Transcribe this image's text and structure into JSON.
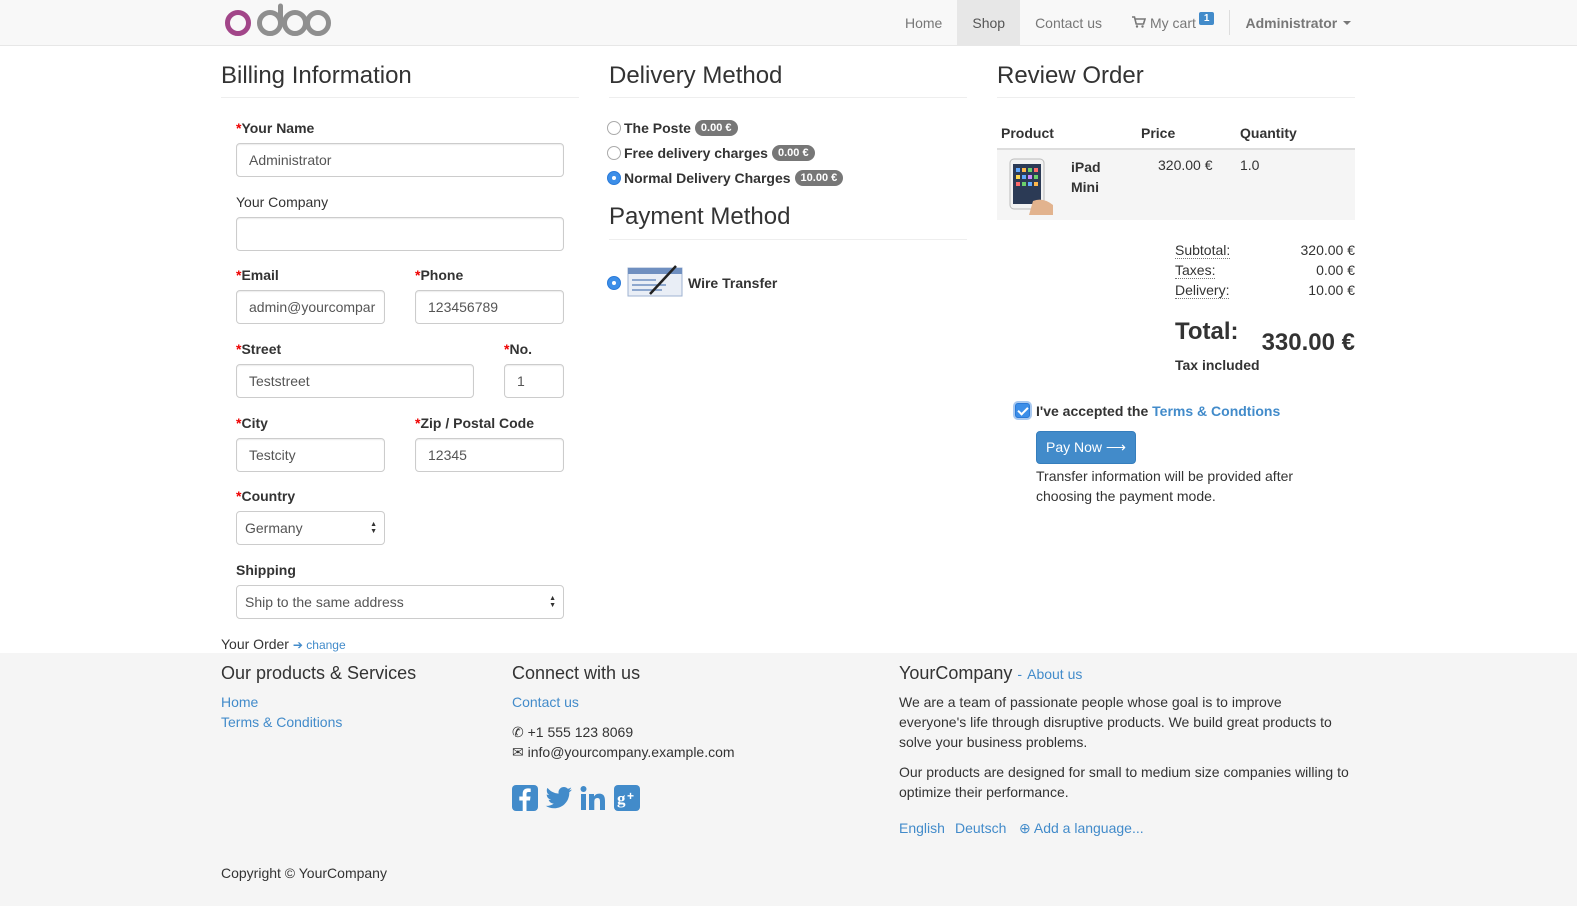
{
  "brand": {
    "logo_text": "odoo",
    "logo_color": "#a24689"
  },
  "nav": {
    "home": "Home",
    "shop": "Shop",
    "contact": "Contact us",
    "cart": "My cart",
    "cart_count": "1",
    "user": "Administrator"
  },
  "billing": {
    "title": "Billing Information",
    "required_mark": "*",
    "name_label": "Your Name",
    "name_value": "Administrator",
    "company_label": "Your Company",
    "company_value": "",
    "email_label": "Email",
    "email_value": "admin@yourcompar",
    "phone_label": "Phone",
    "phone_value": "123456789",
    "street_label": "Street",
    "street_value": "Teststreet",
    "no_label": "No.",
    "no_value": "1",
    "city_label": "City",
    "city_value": "Testcity",
    "zip_label": "Zip / Postal Code",
    "zip_value": "12345",
    "country_label": "Country",
    "country_value": "Germany",
    "shipping_label": "Shipping",
    "shipping_value": "Ship to the same address",
    "your_order_label": "Your Order",
    "change_link": "change"
  },
  "delivery": {
    "title": "Delivery Method",
    "options": [
      {
        "label": "The Poste",
        "price": "0.00 €",
        "selected": false
      },
      {
        "label": "Free delivery charges",
        "price": "0.00 €",
        "selected": false
      },
      {
        "label": "Normal Delivery Charges",
        "price": "10.00 €",
        "selected": true
      }
    ]
  },
  "payment": {
    "title": "Payment Method",
    "option_label": "Wire Transfer"
  },
  "review": {
    "title": "Review Order",
    "col_product": "Product",
    "col_price": "Price",
    "col_quantity": "Quantity",
    "item_name_1": "iPad",
    "item_name_2": "Mini",
    "item_price": "320.00 €",
    "item_qty": "1.0",
    "subtotal_label": "Subtotal:",
    "subtotal_value": "320.00 €",
    "taxes_label": "Taxes:",
    "taxes_value": "0.00 €",
    "delivery_label": "Delivery:",
    "delivery_value": "10.00 €",
    "total_label": "Total:",
    "total_value": "330.00 €",
    "tax_included": "Tax included",
    "accept_text": "I've accepted the",
    "terms_link": "Terms & Condtions",
    "pay_button": "Pay Now",
    "transfer_info_1": "Transfer information will be provided after",
    "transfer_info_2": "choosing the payment mode."
  },
  "footer": {
    "products_title": "Our products & Services",
    "link_home": "Home",
    "link_terms": "Terms & Conditions",
    "connect_title": "Connect with us",
    "link_contact": "Contact us",
    "phone": "+1 555 123 8069",
    "email": "info@yourcompany.example.com",
    "company_title": "YourCompany",
    "about_sep": "-",
    "about_link": "About us",
    "desc_1a": "We are a team of passionate people whose goal is to improve",
    "desc_1b": "everyone's life through disruptive products. We build great products to",
    "desc_1c": "solve your business problems.",
    "desc_2a": "Our products are designed for small to medium size companies willing to",
    "desc_2b": "optimize their performance.",
    "lang_en": "English",
    "lang_de": "Deutsch",
    "add_language": "Add a language...",
    "copyright": "Copyright © YourCompany"
  },
  "colors": {
    "accent": "#428bca",
    "brand_purple": "#a24689",
    "logo_grey": "#8f8f8f"
  }
}
